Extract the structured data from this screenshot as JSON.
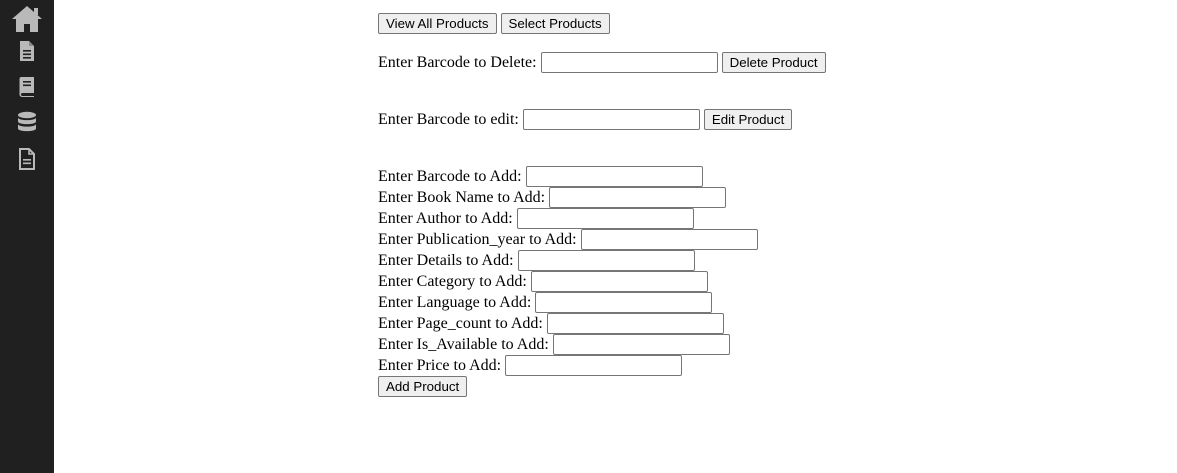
{
  "sidebar": {
    "items": [
      {
        "icon": "home-icon"
      },
      {
        "icon": "document-icon"
      },
      {
        "icon": "book-icon"
      },
      {
        "icon": "database-icon"
      },
      {
        "icon": "file-icon"
      }
    ]
  },
  "top_buttons": {
    "view_all": "View All Products",
    "select": "Select Products"
  },
  "delete_section": {
    "label": "Enter Barcode to Delete:",
    "button": "Delete Product"
  },
  "edit_section": {
    "label": "Enter Barcode to edit:",
    "button": "Edit Product"
  },
  "add_section": {
    "fields": [
      {
        "label": "Enter Barcode to Add:"
      },
      {
        "label": "Enter Book Name to Add:"
      },
      {
        "label": "Enter Author to Add:"
      },
      {
        "label": "Enter Publication_year to Add:"
      },
      {
        "label": "Enter Details to Add:"
      },
      {
        "label": "Enter Category to Add:"
      },
      {
        "label": "Enter Language to Add:"
      },
      {
        "label": "Enter Page_count to Add:"
      },
      {
        "label": "Enter Is_Available to Add:"
      },
      {
        "label": "Enter Price to Add:"
      }
    ],
    "button": "Add Product"
  }
}
